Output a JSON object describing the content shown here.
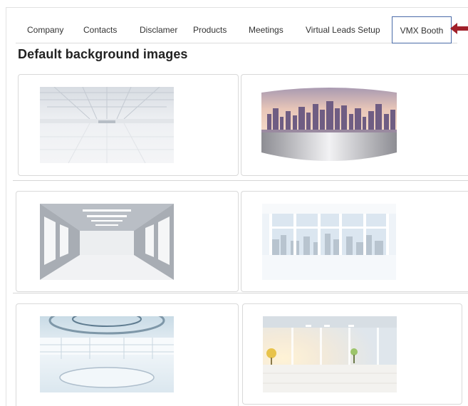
{
  "tabs": [
    {
      "label": "Company"
    },
    {
      "label": "Contacts"
    },
    {
      "label": "Disclamer"
    },
    {
      "label": "Products"
    },
    {
      "label": "Meetings"
    },
    {
      "label": "Virtual Leads Setup"
    },
    {
      "label": "VMX Booth",
      "active": true
    }
  ],
  "section": {
    "title": "Default background images"
  },
  "backgrounds": [
    {
      "name": "white-warehouse"
    },
    {
      "name": "city-skyline-panorama"
    },
    {
      "name": "white-hall-windows"
    },
    {
      "name": "bright-window-room"
    },
    {
      "name": "futuristic-round-room"
    },
    {
      "name": "sunlit-office"
    }
  ],
  "colors": {
    "accent_border": "#4a6ba8",
    "arrow": "#a0202a"
  }
}
